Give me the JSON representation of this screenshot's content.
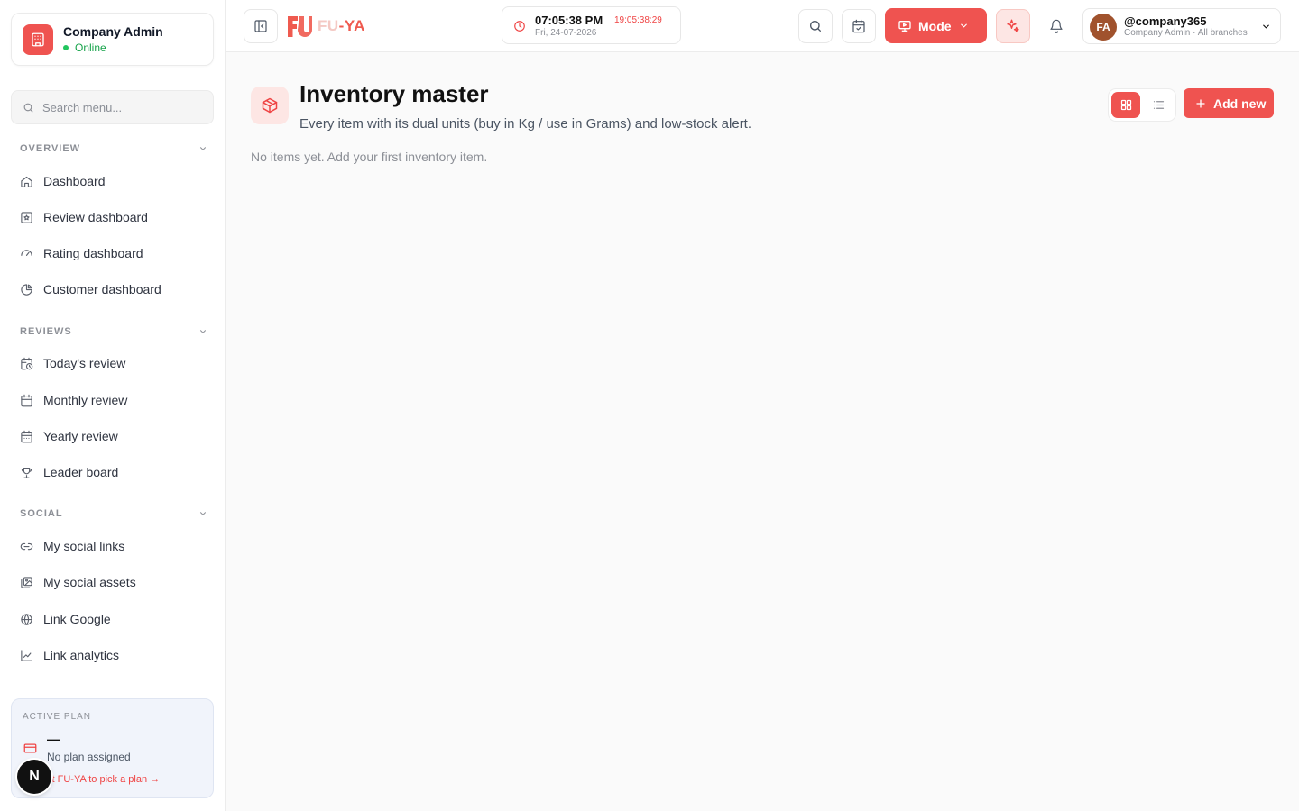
{
  "sidebar": {
    "brand": {
      "name": "Company Admin",
      "status": "Online"
    },
    "search": {
      "placeholder": "Search menu..."
    },
    "sections": [
      {
        "title": "OVERVIEW",
        "items": [
          {
            "label": "Dashboard",
            "icon": "home-icon"
          },
          {
            "label": "Review dashboard",
            "icon": "review-icon"
          },
          {
            "label": "Rating dashboard",
            "icon": "gauge-icon"
          },
          {
            "label": "Customer dashboard",
            "icon": "pie-chart-icon"
          }
        ]
      },
      {
        "title": "REVIEWS",
        "items": [
          {
            "label": "Today's review",
            "icon": "calendar-clock-icon"
          },
          {
            "label": "Monthly review",
            "icon": "calendar-icon"
          },
          {
            "label": "Yearly review",
            "icon": "calendar-icon"
          },
          {
            "label": "Leader board",
            "icon": "trophy-icon"
          }
        ]
      },
      {
        "title": "SOCIAL",
        "items": [
          {
            "label": "My social links",
            "icon": "link-icon"
          },
          {
            "label": "My social assets",
            "icon": "images-icon"
          },
          {
            "label": "Link Google",
            "icon": "globe-icon"
          },
          {
            "label": "Link analytics",
            "icon": "line-chart-icon"
          }
        ]
      }
    ],
    "plan": {
      "title": "ACTIVE PLAN",
      "value": "—",
      "description": "No plan assigned",
      "link": "ct FU-YA to pick a plan →"
    },
    "badge": "N"
  },
  "topbar": {
    "logo": {
      "prefix": "FU",
      "suffix": "-YA"
    },
    "clock": {
      "time": "07:05:38 PM",
      "time24": "19:05:38:29",
      "date": "Fri, 24-07-2026"
    },
    "mode_label": "Mode",
    "user": {
      "initials": "FA",
      "handle": "@company365",
      "role": "Company Admin · All branches"
    }
  },
  "main": {
    "title": "Inventory master",
    "subtitle": "Every item with its dual units (buy in Kg / use in Grams) and low-stock alert.",
    "empty_message": "No items yet. Add your first inventory item.",
    "add_button": "Add new"
  },
  "colors": {
    "accent": "#ef5350",
    "online": "#22c55e",
    "text": "#111111",
    "muted": "#8c8f96"
  }
}
